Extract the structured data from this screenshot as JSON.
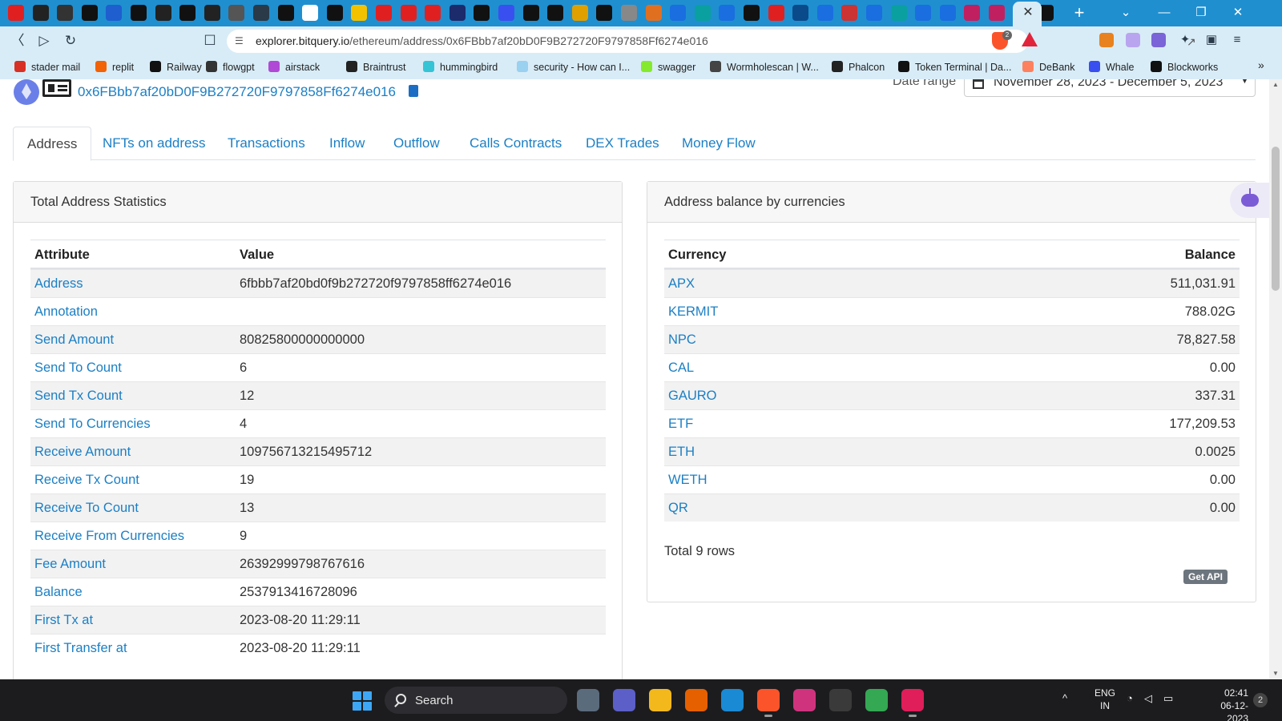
{
  "browser": {
    "url_host": "explorer.bitquery.io",
    "url_path": "/ethereum/address/0x6FBbb7af20bD0F9B272720F9797858Ff6274e016",
    "notification_badge": "2",
    "tab_close": "✕",
    "new_tab": "+",
    "window_controls": [
      "⌄",
      "—",
      "❐",
      "✕"
    ],
    "nav_icons": [
      "back-icon",
      "forward-icon",
      "reload-icon",
      "bookmark-icon"
    ],
    "favicon_colors": [
      "#e02020",
      "#222222",
      "#333333",
      "#111111",
      "#1e5ecf",
      "#111111",
      "#222222",
      "#111111",
      "#222222",
      "#555555",
      "#2a3a48",
      "#111111",
      "#ffffff",
      "#111111",
      "#f2c200",
      "#e02020",
      "#e02020",
      "#e02020",
      "#1b2b6b",
      "#111111",
      "#3a4ff0",
      "#111111",
      "#111111",
      "#e0a000",
      "#111111",
      "#888888",
      "#e07020",
      "#1a6ee0",
      "#0aa0a0",
      "#1a6ee0",
      "#111111",
      "#e02020",
      "#0a4a8a",
      "#1a6ee0",
      "#cc3333",
      "#1a6ee0",
      "#0aa0a0",
      "#1a6ee0",
      "#1a6ee0",
      "#c02060",
      "#c02060",
      "#ffffff",
      "#111111"
    ]
  },
  "bookmarks": [
    {
      "label": "stader mail",
      "color": "#d93025"
    },
    {
      "label": "replit",
      "color": "#f26207"
    },
    {
      "label": "Railway",
      "color": "#111111"
    },
    {
      "label": "flowgpt",
      "color": "#333333"
    },
    {
      "label": "airstack",
      "color": "#b04ad6"
    },
    {
      "label": "Braintrust",
      "color": "#222222"
    },
    {
      "label": "hummingbird",
      "color": "#35c4d6"
    },
    {
      "label": "security - How can I...",
      "color": "#9ad0f0"
    },
    {
      "label": "swagger",
      "color": "#85ea2d"
    },
    {
      "label": "Wormholescan | W...",
      "color": "#444444"
    },
    {
      "label": "Phalcon",
      "color": "#222222"
    },
    {
      "label": "Token Terminal | Da...",
      "color": "#111111"
    },
    {
      "label": "DeBank",
      "color": "#fe815f"
    },
    {
      "label": "Whale",
      "color": "#3a4ff0"
    },
    {
      "label": "Blockworks",
      "color": "#111111"
    }
  ],
  "bookmarks_more": "»",
  "header": {
    "address": "0x6FBbb7af20bD0F9B272720F9797858Ff6274e016",
    "date_label": "Date range",
    "date_value": "November 28, 2023 - December 5, 2023"
  },
  "tabs": [
    "Address",
    "NFTs on address",
    "Transactions",
    "Inflow",
    "Outflow",
    "Calls Contracts",
    "DEX Trades",
    "Money Flow"
  ],
  "stats": {
    "title": "Total Address Statistics",
    "col_attribute": "Attribute",
    "col_value": "Value",
    "rows": [
      {
        "attr": "Address",
        "value": "6fbbb7af20bd0f9b272720f9797858ff6274e016"
      },
      {
        "attr": "Annotation",
        "value": ""
      },
      {
        "attr": "Send Amount",
        "value": "80825800000000000"
      },
      {
        "attr": "Send To Count",
        "value": "6"
      },
      {
        "attr": "Send Tx Count",
        "value": "12"
      },
      {
        "attr": "Send To Currencies",
        "value": "4"
      },
      {
        "attr": "Receive Amount",
        "value": "109756713215495712"
      },
      {
        "attr": "Receive Tx Count",
        "value": "19"
      },
      {
        "attr": "Receive To Count",
        "value": "13"
      },
      {
        "attr": "Receive From Currencies",
        "value": "9"
      },
      {
        "attr": "Fee Amount",
        "value": "26392999798767616"
      },
      {
        "attr": "Balance",
        "value": "2537913416728096"
      },
      {
        "attr": "First Tx at",
        "value": "2023-08-20 11:29:11"
      },
      {
        "attr": "First Transfer at",
        "value": "2023-08-20 11:29:11"
      }
    ]
  },
  "balances": {
    "title": "Address balance by currencies",
    "col_currency": "Currency",
    "col_balance": "Balance",
    "rows": [
      {
        "currency": "APX",
        "balance": "511,031.91"
      },
      {
        "currency": "KERMIT",
        "balance": "788.02G"
      },
      {
        "currency": "NPC",
        "balance": "78,827.58"
      },
      {
        "currency": "CAL",
        "balance": "0.00"
      },
      {
        "currency": "GAURO",
        "balance": "337.31"
      },
      {
        "currency": "ETF",
        "balance": "177,209.53"
      },
      {
        "currency": "ETH",
        "balance": "0.0025"
      },
      {
        "currency": "WETH",
        "balance": "0.00"
      },
      {
        "currency": "QR",
        "balance": "0.00"
      }
    ],
    "total": "Total 9 rows",
    "api_button": "Get API"
  },
  "taskbar": {
    "search": "Search",
    "apps": [
      {
        "name": "task-view-app",
        "color": "#5a6b7c"
      },
      {
        "name": "meet-app",
        "color": "#5b5fc7"
      },
      {
        "name": "file-explorer-app",
        "color": "#f3b81b"
      },
      {
        "name": "firefox-app",
        "color": "#e66000"
      },
      {
        "name": "vscode-app",
        "color": "#1a8ad4"
      },
      {
        "name": "brave-app",
        "color": "#fb542b"
      },
      {
        "name": "intellij-app",
        "color": "#d0337e"
      },
      {
        "name": "qt-app",
        "color": "#3a3a3a"
      },
      {
        "name": "chrome-app",
        "color": "#34a853"
      },
      {
        "name": "slack-app",
        "color": "#e01e5a"
      }
    ],
    "lang_top": "ENG",
    "lang_bottom": "IN",
    "time": "02:41",
    "date": "06-12-2023",
    "notifications": "2",
    "tray_chevron": "^"
  }
}
